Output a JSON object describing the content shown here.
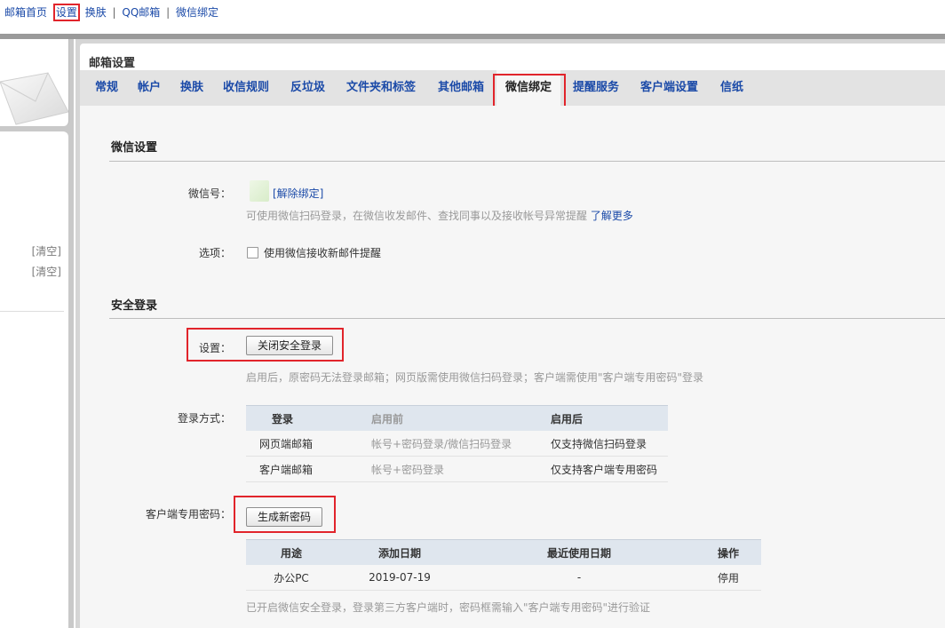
{
  "topnav": {
    "home": "邮箱首页",
    "settings": "设置",
    "skin": "换肤",
    "qqmail": "QQ邮箱",
    "wechat_bind": "微信绑定",
    "sep": "|"
  },
  "sidebar": {
    "clear1": "[清空]",
    "clear2": "[清空]"
  },
  "panel": {
    "title": "邮箱设置"
  },
  "tabs": [
    "常规",
    "帐户",
    "换肤",
    "收信规则",
    "反垃圾",
    "文件夹和标签",
    "其他邮箱",
    "微信绑定",
    "提醒服务",
    "客户端设置",
    "信纸"
  ],
  "active_tab": "微信绑定",
  "wechat": {
    "section_title": "微信设置",
    "account_label": "微信号：",
    "unbind_link": "[解除绑定]",
    "hint": "可使用微信扫码登录，在微信收发邮件、查找同事以及接收帐号异常提醒",
    "learn_more": "了解更多",
    "option_label": "选项：",
    "option_checkbox": "使用微信接收新邮件提醒",
    "option_checked": false
  },
  "secure": {
    "section_title": "安全登录",
    "setting_label": "设置：",
    "close_button": "关闭安全登录",
    "hint": "启用后，原密码无法登录邮箱；网页版需使用微信扫码登录；客户端需使用\"客户端专用密码\"登录",
    "method_label": "登录方式：",
    "method_table": {
      "headers": [
        "登录",
        "启用前",
        "启用后"
      ],
      "rows": [
        [
          "网页端邮箱",
          "帐号+密码登录/微信扫码登录",
          "仅支持微信扫码登录"
        ],
        [
          "客户端邮箱",
          "帐号+密码登录",
          "仅支持客户端专用密码"
        ]
      ]
    },
    "client_pw_label": "客户端专用密码：",
    "generate_button": "生成新密码",
    "pw_table": {
      "headers": [
        "用途",
        "添加日期",
        "最近使用日期",
        "操作"
      ],
      "rows": [
        [
          "办公PC",
          "2019-07-19",
          "-",
          "停用"
        ]
      ]
    },
    "footer_hint": "已开启微信安全登录，登录第三方客户端时，密码框需输入\"客户端专用密码\"进行验证"
  },
  "colors": {
    "highlight": "#e1242b",
    "link": "#1b4aa8"
  }
}
